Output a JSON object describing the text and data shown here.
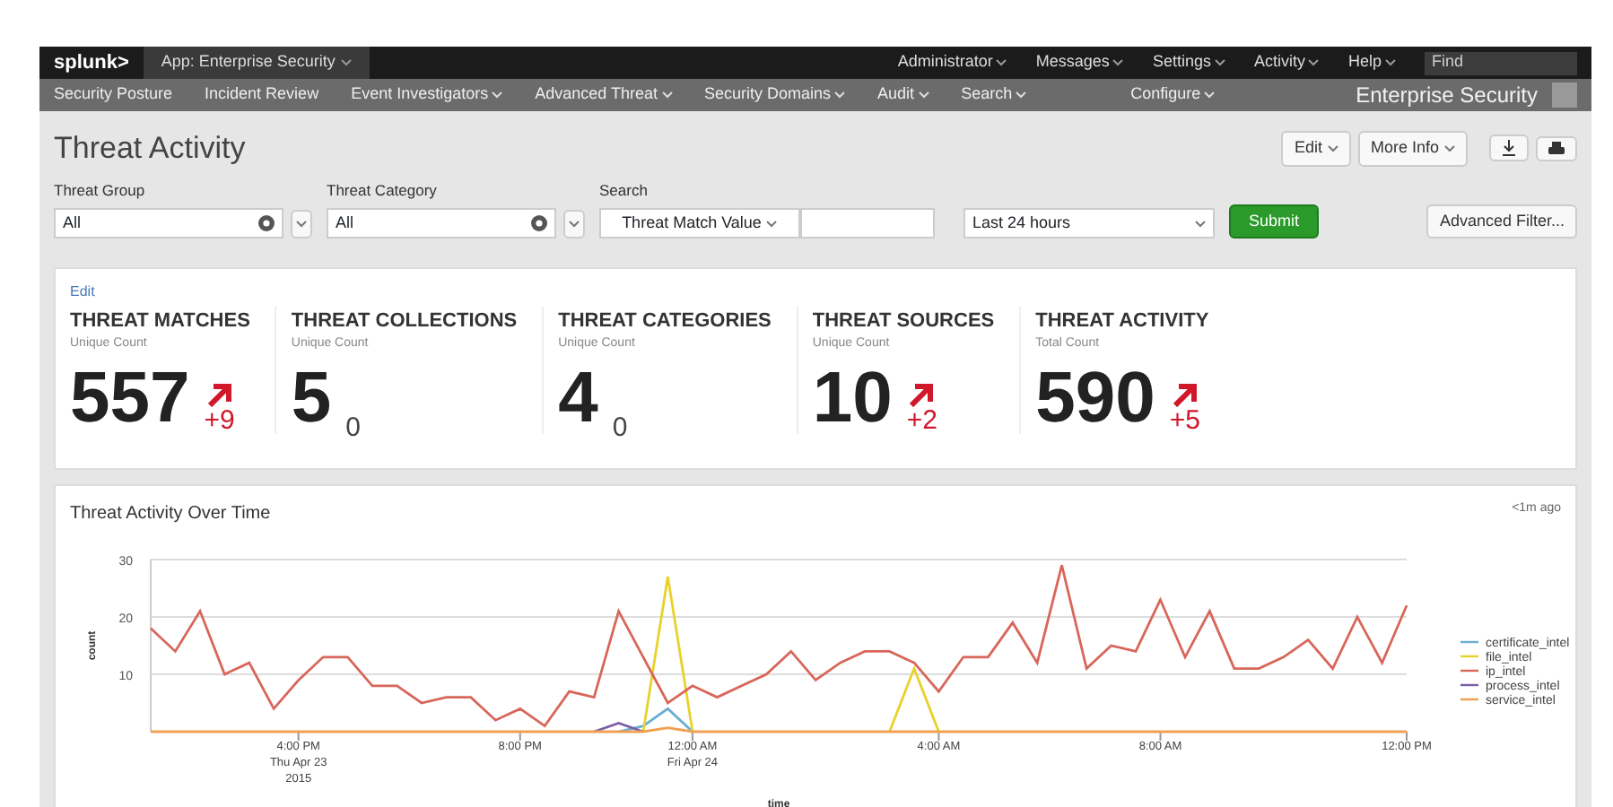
{
  "app_bar": {
    "logo": "splunk>",
    "app": "App: Enterprise Security",
    "menus": [
      {
        "label": "Administrator"
      },
      {
        "label": "Messages"
      },
      {
        "label": "Settings"
      },
      {
        "label": "Activity"
      },
      {
        "label": "Help"
      }
    ],
    "find": {
      "placeholder": "Find"
    }
  },
  "nav": {
    "items": [
      {
        "label": "Security Posture",
        "dropdown": false
      },
      {
        "label": "Incident Review",
        "dropdown": false
      },
      {
        "label": "Event Investigators",
        "dropdown": true
      },
      {
        "label": "Advanced Threat",
        "dropdown": true
      },
      {
        "label": "Security Domains",
        "dropdown": true
      },
      {
        "label": "Audit",
        "dropdown": true
      },
      {
        "label": "Search",
        "dropdown": true
      },
      {
        "label": "Configure",
        "dropdown": true
      }
    ],
    "brand": "Enterprise Security"
  },
  "page": {
    "title": "Threat Activity",
    "buttons": [
      {
        "label": "Edit"
      },
      {
        "label": "More Info"
      }
    ]
  },
  "filters": {
    "threat_group": {
      "label": "Threat Group",
      "value": "All"
    },
    "threat_category": {
      "label": "Threat Category",
      "value": "All"
    },
    "search": {
      "label": "Search",
      "field": "Threat Match Value"
    },
    "time": {
      "value": "Last 24 hours"
    },
    "submit": "Submit",
    "advanced": "Advanced Filter..."
  },
  "kpis": {
    "edit": "Edit",
    "items": [
      {
        "title": "THREAT MATCHES",
        "subtitle": "Unique Count",
        "value": "557",
        "delta": "+9",
        "rising": true
      },
      {
        "title": "THREAT COLLECTIONS",
        "subtitle": "Unique Count",
        "value": "5",
        "delta": "0",
        "rising": false
      },
      {
        "title": "THREAT CATEGORIES",
        "subtitle": "Unique Count",
        "value": "4",
        "delta": "0",
        "rising": false
      },
      {
        "title": "THREAT SOURCES",
        "subtitle": "Unique Count",
        "value": "10",
        "delta": "+2",
        "rising": true
      },
      {
        "title": "THREAT ACTIVITY",
        "subtitle": "Total Count",
        "value": "590",
        "delta": "+5",
        "rising": true
      }
    ]
  },
  "chart_panel": {
    "title": "Threat Activity Over Time",
    "updated": "<1m ago",
    "chart_data": {
      "type": "line",
      "xlabel": "time",
      "ylabel": "count",
      "categories": [
        null,
        null,
        null,
        null,
        null,
        null,
        "4:00 PM\nThu Apr 23\n2015",
        null,
        null,
        null,
        null,
        null,
        null,
        null,
        null,
        "8:00 PM",
        null,
        null,
        null,
        null,
        null,
        null,
        "12:00 AM\nFri Apr 24",
        null,
        null,
        null,
        null,
        null,
        null,
        null,
        null,
        null,
        "4:00 AM",
        null,
        null,
        null,
        null,
        null,
        null,
        null,
        null,
        "8:00 AM",
        null,
        null,
        null,
        null,
        null,
        null,
        null,
        null,
        null,
        "12:00 PM"
      ],
      "ylim": [
        0,
        30
      ],
      "yticks": [
        {
          "value": 10,
          "label": "10"
        },
        {
          "value": 20,
          "label": "20"
        },
        {
          "value": 30,
          "label": "30"
        }
      ],
      "legend": "right",
      "series": [
        {
          "name": "certificate_intel",
          "color": "#6aaed6",
          "values": [
            null,
            null,
            null,
            null,
            null,
            null,
            null,
            null,
            null,
            null,
            null,
            null,
            null,
            null,
            null,
            null,
            null,
            null,
            null,
            0,
            1,
            4,
            0,
            null,
            null,
            null,
            null,
            null,
            null,
            null,
            null,
            null,
            null,
            null,
            null,
            null,
            null,
            null,
            null,
            null,
            null,
            null,
            null,
            null,
            null,
            null,
            null,
            null,
            null,
            null,
            null,
            null
          ]
        },
        {
          "name": "file_intel",
          "color": "#e8d22a",
          "values": [
            null,
            null,
            null,
            null,
            null,
            null,
            null,
            null,
            null,
            null,
            null,
            null,
            null,
            null,
            null,
            null,
            null,
            null,
            null,
            null,
            0,
            27,
            0,
            null,
            null,
            null,
            null,
            null,
            null,
            null,
            0,
            11,
            0,
            null,
            null,
            null,
            null,
            null,
            null,
            null,
            null,
            null,
            null,
            null,
            null,
            null,
            null,
            null,
            null,
            null,
            null,
            null
          ]
        },
        {
          "name": "ip_intel",
          "color": "#d8665a",
          "values": [
            18,
            14,
            21,
            10,
            12,
            4,
            9,
            13,
            13,
            8,
            8,
            5,
            6,
            6,
            2,
            4,
            1,
            7,
            6,
            21,
            13,
            5,
            8,
            6,
            8,
            10,
            14,
            9,
            12,
            14,
            14,
            12,
            7,
            13,
            13,
            19,
            12,
            29,
            11,
            15,
            14,
            23,
            13,
            21,
            11,
            11,
            13,
            16,
            11,
            20,
            12,
            22
          ]
        },
        {
          "name": "process_intel",
          "color": "#7b5ea7",
          "values": [
            null,
            null,
            null,
            null,
            null,
            null,
            null,
            null,
            null,
            null,
            null,
            null,
            null,
            null,
            null,
            null,
            null,
            null,
            0,
            1.5,
            0,
            null,
            null,
            null,
            null,
            null,
            null,
            null,
            null,
            null,
            null,
            null,
            null,
            null,
            null,
            null,
            null,
            null,
            null,
            null,
            null,
            null,
            null,
            null,
            null,
            null,
            null,
            null,
            null,
            null,
            null,
            null
          ]
        },
        {
          "name": "service_intel",
          "color": "#f0a050",
          "values": [
            0,
            0,
            0,
            0,
            0,
            0,
            0,
            0,
            0,
            0,
            0,
            0,
            0,
            0,
            0,
            0,
            0,
            0,
            0,
            0,
            0,
            0.7,
            0,
            0,
            0,
            0,
            0,
            0,
            0,
            0,
            0,
            0,
            0,
            0,
            0,
            0,
            0,
            0,
            0,
            0,
            0,
            0,
            0,
            0,
            0,
            0,
            0,
            0,
            0,
            0,
            0,
            0
          ]
        }
      ]
    }
  }
}
